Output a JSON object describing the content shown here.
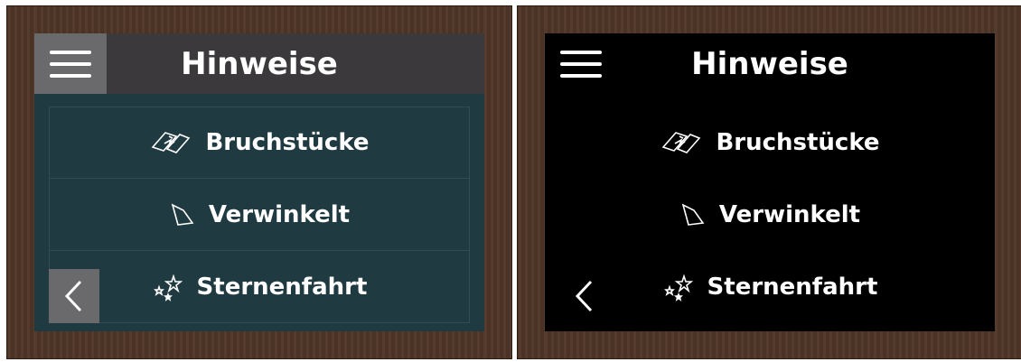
{
  "screens": [
    {
      "variant": "dark-teal",
      "header": {
        "title": "Hinweise",
        "menu_icon": "hamburger-icon"
      },
      "items": [
        {
          "label": "Bruchstücke",
          "icon": "broken-ticket-icon"
        },
        {
          "label": "Verwinkelt",
          "icon": "angled-shape-icon"
        },
        {
          "label": "Sternenfahrt",
          "icon": "stars-icon"
        }
      ],
      "back_icon": "chevron-left-icon"
    },
    {
      "variant": "black",
      "header": {
        "title": "Hinweise",
        "menu_icon": "hamburger-icon"
      },
      "items": [
        {
          "label": "Bruchstücke",
          "icon": "broken-ticket-icon"
        },
        {
          "label": "Verwinkelt",
          "icon": "angled-shape-icon"
        },
        {
          "label": "Sternenfahrt",
          "icon": "stars-icon"
        }
      ],
      "back_icon": "chevron-left-icon"
    }
  ],
  "colors": {
    "frame_wood": "#4e3526",
    "screen_teal": "#1f3a40",
    "header_gray": "#3b393c",
    "button_gray": "#6a696c",
    "screen_black": "#000000",
    "text": "#ffffff"
  }
}
